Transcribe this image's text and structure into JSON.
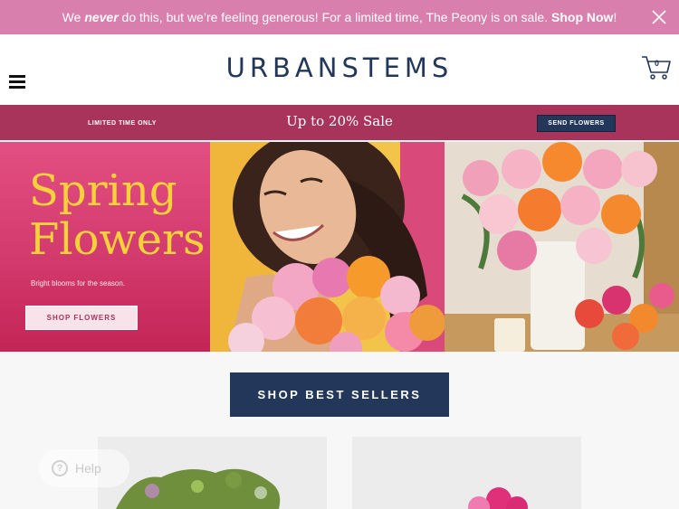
{
  "promo": {
    "text_before": "We ",
    "text_emph": "never",
    "text_after": " do this, but we’re feeling generous! For a limited time, The Peony is on sale. ",
    "link": "Shop Now",
    "text_end": "!"
  },
  "header": {
    "logo": "URBANSTEMS",
    "cart_count": "0"
  },
  "salebar": {
    "limited": "LIMITED TIME ONLY",
    "title": "Up to 20% Sale",
    "send_button": "SEND FLOWERS"
  },
  "hero": {
    "title_line1": "Spring",
    "title_line2": "Flowers",
    "subtitle": "Bright blooms for the season.",
    "button": "SHOP FLOWERS"
  },
  "best_sellers": {
    "button": "SHOP BEST SELLERS"
  },
  "help": {
    "label": "Help"
  },
  "colors": {
    "promo": "#d97fae",
    "sale": "#a8345b",
    "navy": "#22375a",
    "hero_yellow": "#f6d23a"
  }
}
